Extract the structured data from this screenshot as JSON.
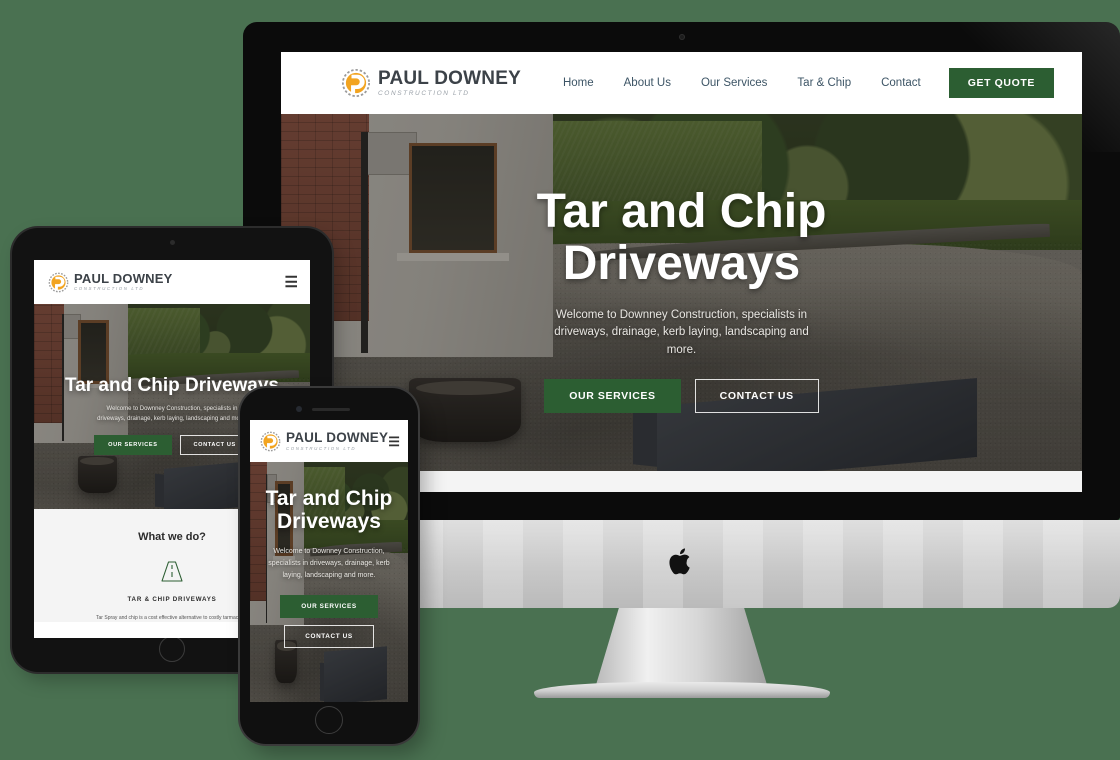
{
  "page": {
    "background_color": "#4a7151",
    "mockup_type": "responsive-website-device-mockup"
  },
  "brand": {
    "name": "PAUL DOWNEY",
    "tagline": "CONSTRUCTION LTD",
    "logo_icon": "gear-d-logo-icon",
    "logo_color": "#f2a420",
    "name_color": "#3c4248"
  },
  "desktop": {
    "device": "imac",
    "nav": {
      "links": [
        {
          "label": "Home"
        },
        {
          "label": "About Us"
        },
        {
          "label": "Our Services"
        },
        {
          "label": "Tar & Chip"
        },
        {
          "label": "Contact"
        }
      ],
      "cta": "GET QUOTE",
      "cta_color": "#2c5e32"
    },
    "hero": {
      "title_line1": "Tar and Chip",
      "title_line2": "Driveways",
      "subtitle": "Welcome to Downney Construction, specialists in driveways, drainage, kerb laying, landscaping and more.",
      "primary_button": "OUR SERVICES",
      "secondary_button": "CONTACT US"
    }
  },
  "tablet": {
    "device": "ipad",
    "nav": {
      "menu_icon": "hamburger-menu-icon"
    },
    "hero": {
      "title": "Tar and Chip Driveways",
      "subtitle": "Welcome to Downney Construction, specialists in driveways, drainage, kerb laying, landscaping and more.",
      "primary_button": "OUR SERVICES",
      "secondary_button": "CONTACT US"
    },
    "what_we_do": {
      "heading": "What we do?",
      "service_icon": "road-driveway-icon",
      "service_title": "TAR & CHIP DRIVEWAYS",
      "service_body": "Tar Spray and chip is a cost effective alternative to costly tarmac and"
    }
  },
  "phone": {
    "device": "iphone",
    "nav": {
      "menu_icon": "hamburger-menu-icon"
    },
    "hero": {
      "title_line1": "Tar and Chip",
      "title_line2": "Driveways",
      "subtitle": "Welcome to Downney Construction, specialists in driveways, drainage, kerb laying, landscaping and more.",
      "primary_button": "OUR SERVICES",
      "secondary_button": "CONTACT US"
    }
  }
}
